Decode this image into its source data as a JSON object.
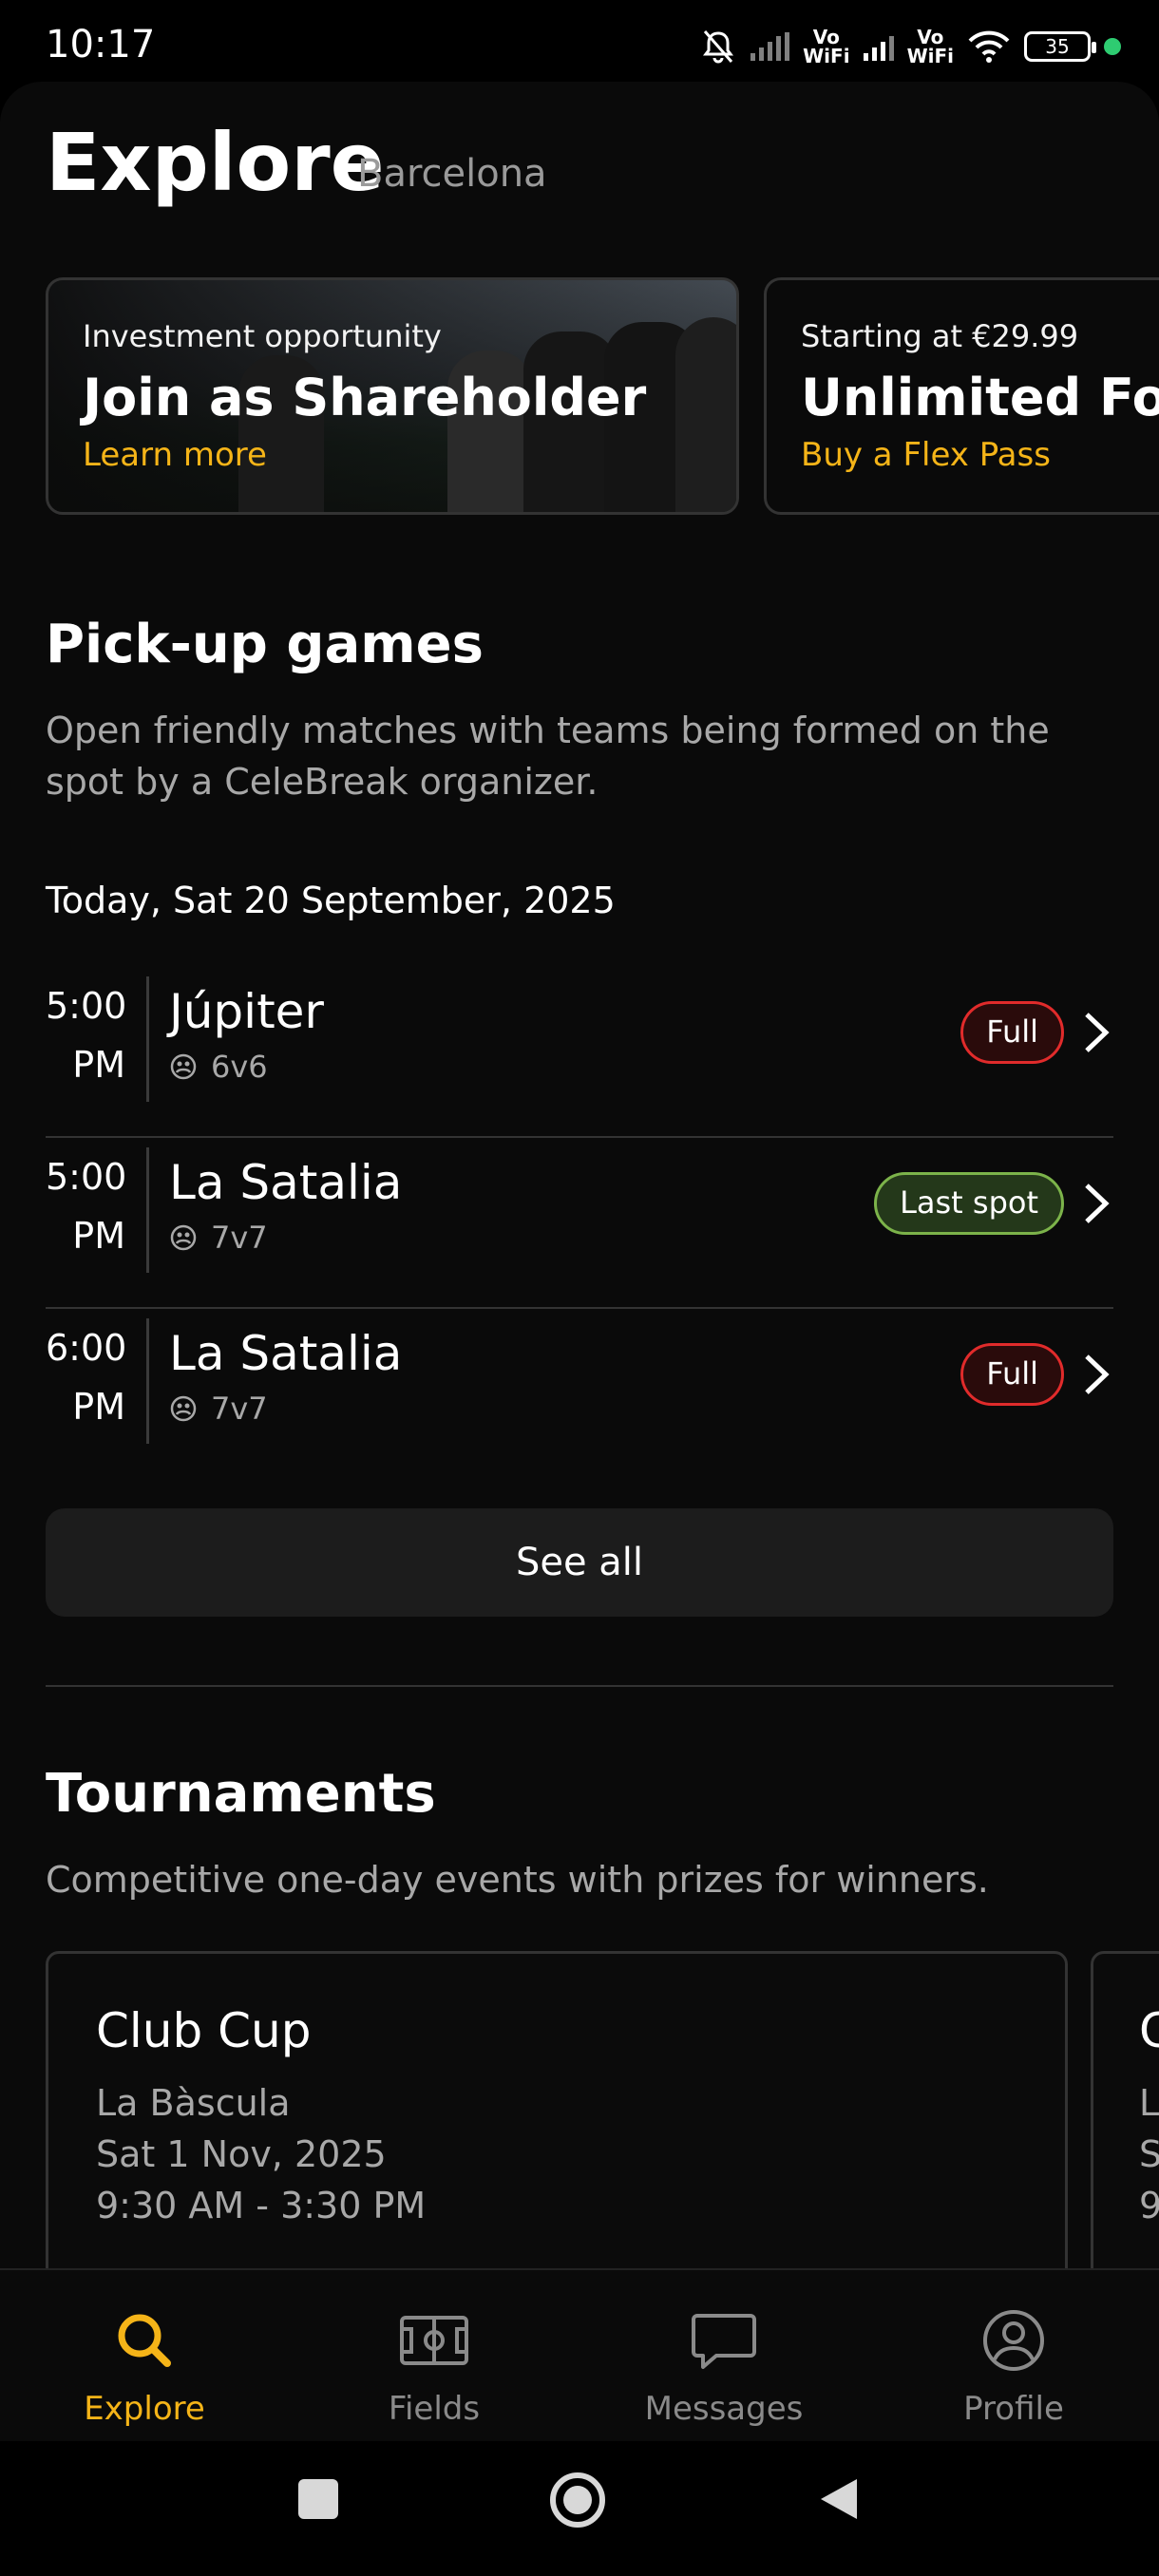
{
  "status_bar": {
    "time": "10:17",
    "vowifi_1": "Vo\nWiFi",
    "vowifi_2": "Vo\nWiFi",
    "battery": "35"
  },
  "header": {
    "title": "Explore",
    "city": "Barcelona"
  },
  "promos": [
    {
      "kicker": "Investment opportunity",
      "title": "Join as Shareholder",
      "link": "Learn more"
    },
    {
      "kicker": "Starting at €29.99",
      "title": "Unlimited Foot",
      "link": "Buy a Flex Pass"
    }
  ],
  "pickup": {
    "title": "Pick-up games",
    "description": "Open friendly matches with teams being formed on the spot by a CeleBreak organizer.",
    "date_label": "Today, Sat 20 September, 2025",
    "games": [
      {
        "time": "5:00",
        "period": "PM",
        "venue": "Júpiter",
        "format": "6v6",
        "status": "Full"
      },
      {
        "time": "5:00",
        "period": "PM",
        "venue": "La Satalia",
        "format": "7v7",
        "status": "Last spot"
      },
      {
        "time": "6:00",
        "period": "PM",
        "venue": "La Satalia",
        "format": "7v7",
        "status": "Full"
      }
    ],
    "see_all": "See all"
  },
  "tournaments": {
    "title": "Tournaments",
    "description": "Competitive one-day events with prizes for winners.",
    "cards": [
      {
        "name": "Club Cup",
        "venue": "La Bàscula",
        "date": "Sat 1 Nov, 2025",
        "hours": "9:30 AM - 3:30 PM"
      },
      {
        "name": "C",
        "venue": "L",
        "date": "S",
        "hours": "9"
      }
    ]
  },
  "nav": {
    "items": [
      {
        "label": "Explore",
        "icon": "search-icon",
        "active": true
      },
      {
        "label": "Fields",
        "icon": "field-icon",
        "active": false
      },
      {
        "label": "Messages",
        "icon": "chat-bubble-icon",
        "active": false
      },
      {
        "label": "Profile",
        "icon": "person-icon",
        "active": false
      }
    ]
  },
  "colors": {
    "accent": "#f5b418",
    "full_badge": "#e12b2b",
    "last_spot_badge": "#7cb34a",
    "background": "#0a0a0a"
  }
}
